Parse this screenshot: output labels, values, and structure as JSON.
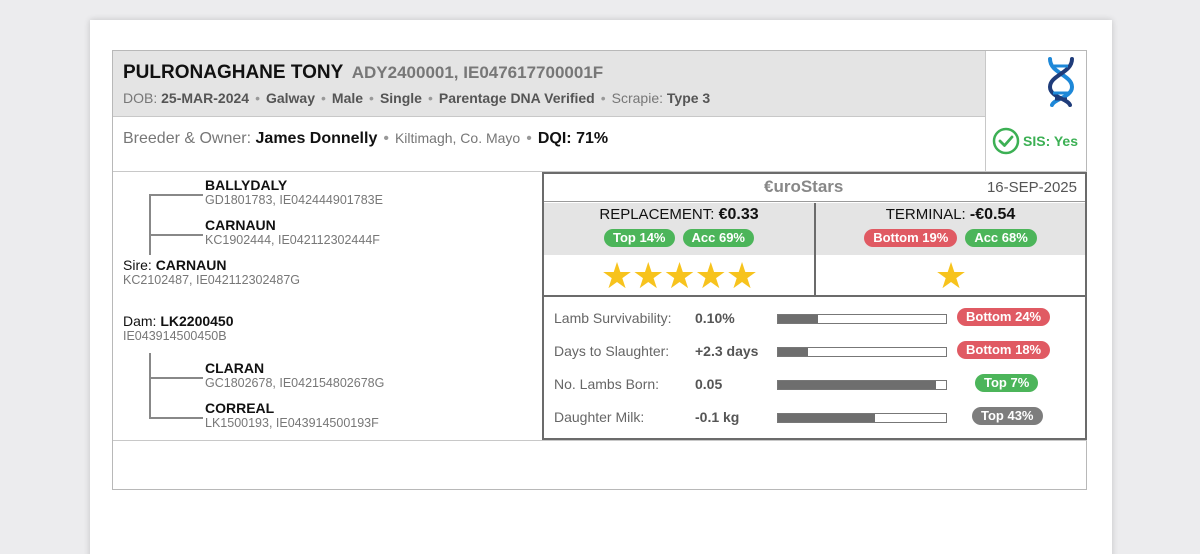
{
  "animal": {
    "name": "PULRONAGHANE TONY",
    "ids": "ADY2400001, IE047617700001F",
    "dob_label": "DOB:",
    "dob": "25-MAR-2024",
    "county": "Galway",
    "sex": "Male",
    "birth_type": "Single",
    "parentage": "Parentage DNA Verified",
    "scrapie_label": "Scrapie:",
    "scrapie": "Type 3",
    "breeder_label": "Breeder & Owner:",
    "breeder": "James Donnelly",
    "location": "Kiltimagh, Co. Mayo",
    "dqi": "DQI: 71%",
    "sis": "SIS: Yes"
  },
  "pedigree": {
    "sire_label": "Sire:",
    "dam_label": "Dam:",
    "sire_sire": {
      "name": "BALLYDALY",
      "id": "GD1801783, IE042444901783E"
    },
    "sire_dam": {
      "name": "CARNAUN",
      "id": "KC1902444, IE042112302444F"
    },
    "sire": {
      "name": "CARNAUN",
      "id": "KC2102487, IE042112302487G"
    },
    "dam": {
      "name": "LK2200450",
      "id": "IE043914500450B"
    },
    "dam_sire": {
      "name": "CLARAN",
      "id": "GC1802678, IE042154802678G"
    },
    "dam_dam": {
      "name": "CORREAL",
      "id": "LK1500193, IE043914500193F"
    }
  },
  "eurostars": {
    "logo": "€uroStars",
    "date": "16-SEP-2025",
    "replacement": {
      "label": "REPLACEMENT:",
      "value": "€0.33",
      "rank": "Top 14%",
      "acc": "Acc 69%",
      "stars": "★★★★★",
      "star_count": 5
    },
    "terminal": {
      "label": "TERMINAL:",
      "value": "-€0.54",
      "rank": "Bottom 19%",
      "acc": "Acc 68%",
      "stars": "★",
      "star_count": 1
    }
  },
  "traits": [
    {
      "label": "Lamb Survivability:",
      "value": "0.10%",
      "fill": 0.24,
      "rank": "Bottom 24%",
      "status": "red"
    },
    {
      "label": "Days to Slaughter:",
      "value": "+2.3 days",
      "fill": 0.18,
      "rank": "Bottom 18%",
      "status": "red"
    },
    {
      "label": "No. Lambs Born:",
      "value": "0.05",
      "fill": 0.94,
      "rank": "Top 7%",
      "status": "green"
    },
    {
      "label": "Daughter Milk:",
      "value": "-0.1 kg",
      "fill": 0.58,
      "rank": "Top 43%",
      "status": "grey"
    }
  ],
  "colors": {
    "green": "#4cb55a",
    "red": "#e05a63",
    "grey": "#7d7d7d",
    "star": "#f7c31d",
    "dna_blue": "#1e88d8",
    "dna_navy": "#1f3c7a"
  }
}
